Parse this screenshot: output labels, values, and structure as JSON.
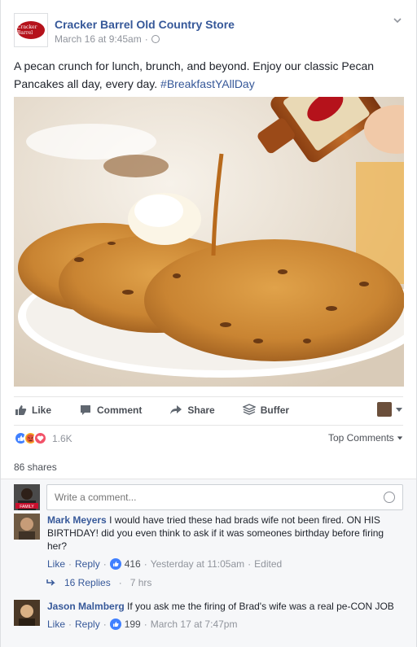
{
  "post": {
    "page_name": "Cracker Barrel Old Country Store",
    "timestamp": "March 16 at 9:45am",
    "separator": "·",
    "logo_text": "Cracker Barrel",
    "text": "A pecan crunch for lunch, brunch, and beyond. Enjoy our classic Pecan Pancakes all day, every day. ",
    "hashtag": "#BreakfastYAllDay"
  },
  "actions": {
    "like": "Like",
    "comment": "Comment",
    "share": "Share",
    "buffer": "Buffer"
  },
  "reactions": {
    "count": "1.6K",
    "top_comments": "Top Comments",
    "shares": "86 shares"
  },
  "composer": {
    "placeholder": "Write a comment...",
    "avatar_badge": "FAMILY"
  },
  "comments": [
    {
      "name": "Mark Meyers",
      "text": "I would have tried these had brads wife not been fired. ON HIS BIRTHDAY! did you even think to ask if it was someones birthday before firing her?",
      "like": "Like",
      "reply": "Reply",
      "likes": "416",
      "time": "Yesterday at 11:05am",
      "edited": "Edited"
    },
    {
      "name": "Jason Malmberg",
      "text": "If you ask me the firing of Brad's wife was a real pe-CON JOB",
      "like": "Like",
      "reply": "Reply",
      "likes": "199",
      "time": "March 17 at 7:47pm"
    }
  ],
  "replies": {
    "label": "16 Replies",
    "time": "7 hrs"
  },
  "colors": {
    "link": "#365899",
    "like_blue": "#4080ff",
    "angry": "#f7b125",
    "love": "#f25268"
  }
}
